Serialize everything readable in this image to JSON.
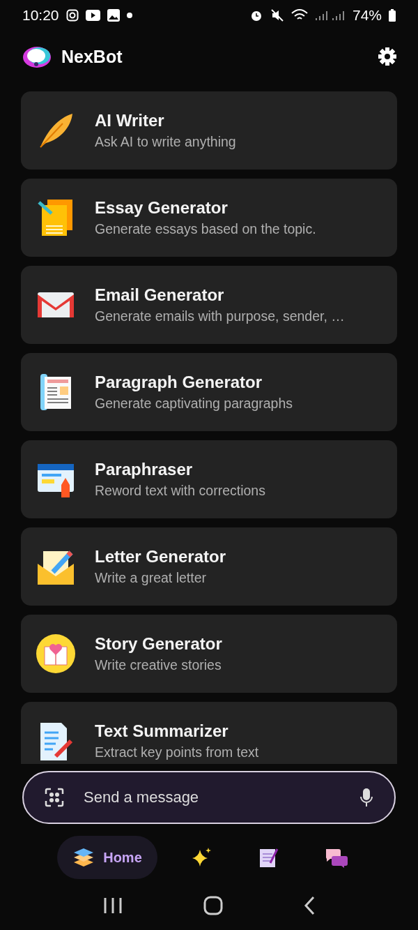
{
  "status_bar": {
    "time": "10:20",
    "battery": "74%"
  },
  "header": {
    "title": "NexBot"
  },
  "tools": [
    {
      "title": "AI Writer",
      "subtitle": "Ask AI to write anything"
    },
    {
      "title": "Essay Generator",
      "subtitle": "Generate essays based on the topic."
    },
    {
      "title": "Email Generator",
      "subtitle": "Generate emails with purpose, sender, …"
    },
    {
      "title": "Paragraph Generator",
      "subtitle": "Generate captivating paragraphs"
    },
    {
      "title": "Paraphraser",
      "subtitle": "Reword text with corrections"
    },
    {
      "title": "Letter Generator",
      "subtitle": "Write a great letter"
    },
    {
      "title": "Story Generator",
      "subtitle": "Write creative stories"
    },
    {
      "title": "Text Summarizer",
      "subtitle": "Extract key points from text"
    }
  ],
  "message_input": {
    "placeholder": "Send a message"
  },
  "bottom_nav": [
    {
      "label": "Home",
      "selected": true
    },
    {
      "selected": false
    },
    {
      "selected": false
    },
    {
      "selected": false
    }
  ]
}
